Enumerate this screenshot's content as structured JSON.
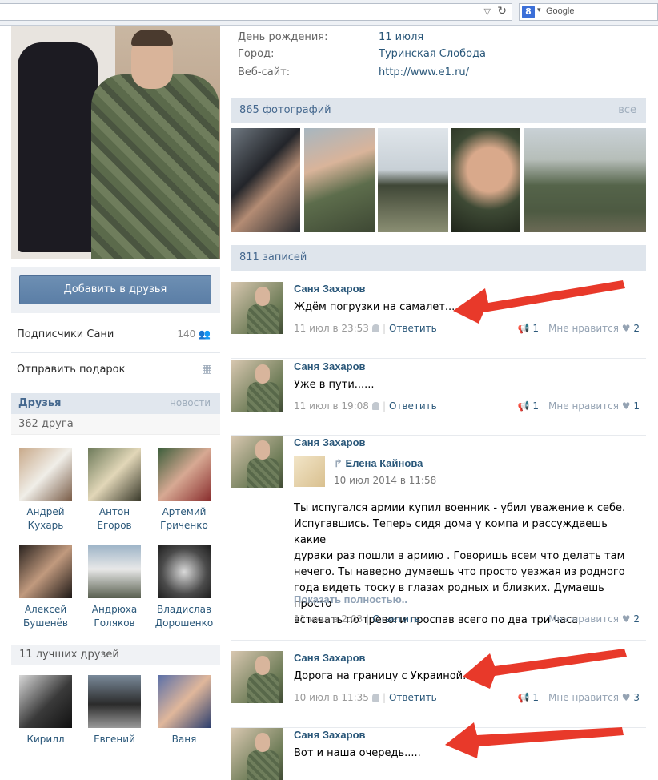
{
  "browser": {
    "search_placeholder": "Google",
    "search_logo": "8"
  },
  "profile": {
    "info": [
      {
        "key": "День рождения:",
        "value": "11 июля"
      },
      {
        "key": "Город:",
        "value": "Туринская Слобода"
      },
      {
        "key": "Веб-сайт:",
        "value": "http://www.e1.ru/"
      }
    ]
  },
  "sidebar": {
    "add_friend_label": "Добавить в друзья",
    "subscribers_label": "Подписчики Сани",
    "subscribers_count": "140",
    "gift_label": "Отправить подарок",
    "friends_title": "Друзья",
    "friends_news": "новости",
    "friends_count": "362 друга",
    "friends": [
      {
        "first": "Андрей",
        "last": "Кухарь"
      },
      {
        "first": "Антон",
        "last": "Егоров"
      },
      {
        "first": "Артемий",
        "last": "Гриченко"
      },
      {
        "first": "Алексей",
        "last": "Бушенёв"
      },
      {
        "first": "Андрюха",
        "last": "Голяков"
      },
      {
        "first": "Владислав",
        "last": "Дорошенко"
      }
    ],
    "best_title": "11 лучших друзей",
    "best": [
      {
        "name": "Кирилл"
      },
      {
        "name": "Евгений"
      },
      {
        "name": "Ваня"
      }
    ]
  },
  "photos": {
    "title": "865 фотографий",
    "all_label": "все"
  },
  "wall": {
    "title": "811 записей",
    "posts": [
      {
        "author": "Саня Захаров",
        "text": "Ждём погрузки на самалет....",
        "date": "11 июл в 23:53",
        "reply": "Ответить",
        "shares": "1",
        "like_label": "Мне нравится",
        "likes": "2"
      },
      {
        "author": "Саня Захаров",
        "text": "Уже в пути......",
        "date": "11 июл в 19:08",
        "reply": "Ответить",
        "shares": "1",
        "like_label": "Мне нравится",
        "likes": "1"
      },
      {
        "author": "Саня Захаров",
        "repost_author": "Елена Кайнова",
        "repost_date": "10 июл 2014 в 11:58",
        "text_lines": [
          "Ты испугался армии купил военник - убил уважение к себе.",
          "Испугавшись. Теперь сидя дома у компа и рассуждаешь какие",
          "дураки раз пошли в армию . Говоришь всем что делать там",
          "нечего. Ты наверно думаешь что просто уезжая из родного",
          "года видеть тоску в глазах родных и близких. Думаешь просто",
          "вставать по тревоги проспав всего по два три часа."
        ],
        "more": "Показать полностью..",
        "date": "11 июл в 2:03",
        "reply": "Ответить",
        "like_label": "Мне нравится",
        "likes": "2"
      },
      {
        "author": "Саня Захаров",
        "text": "Дорога на границу с Украиной....",
        "date": "10 июл в 11:35",
        "reply": "Ответить",
        "shares": "1",
        "like_label": "Мне нравится",
        "likes": "3"
      },
      {
        "author": "Саня Захаров",
        "text": "Вот и наша очередь....."
      }
    ]
  },
  "colors": {
    "link": "#2b587a",
    "header_bg": "#dfe5ec",
    "arrow": "#e8392a"
  }
}
